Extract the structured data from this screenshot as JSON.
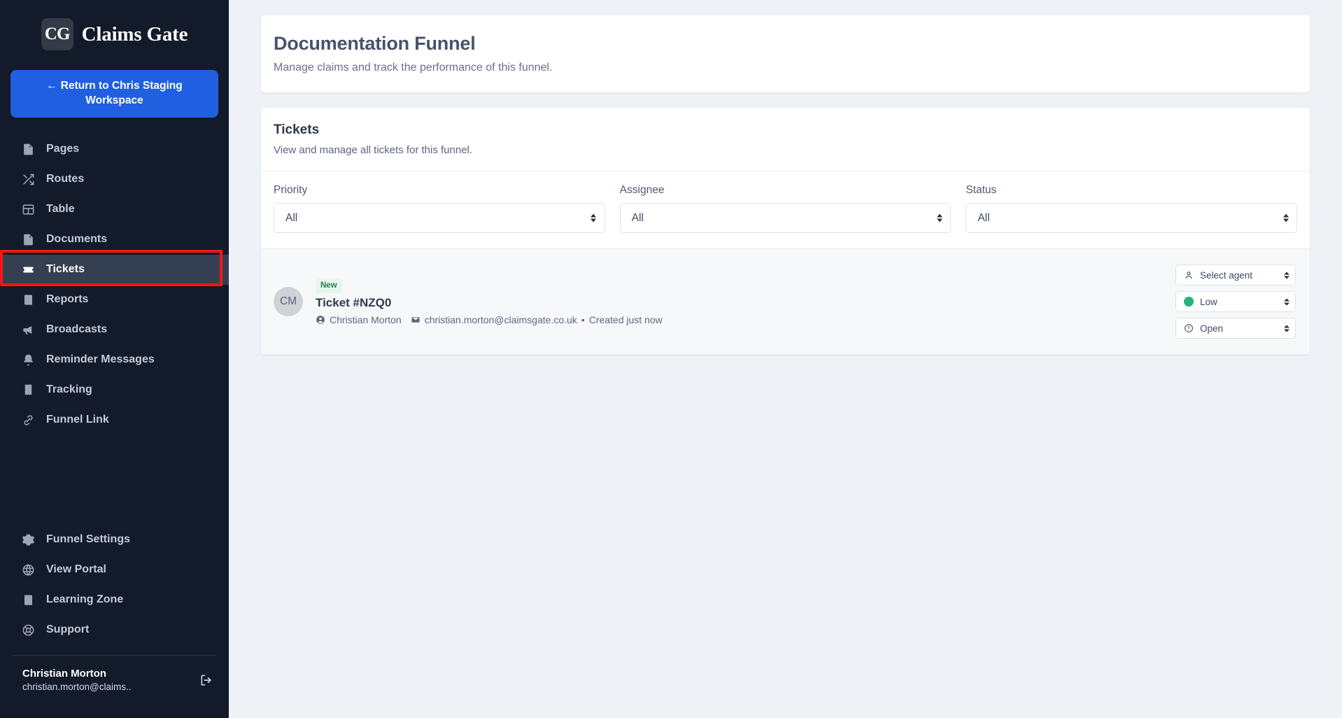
{
  "sidebar": {
    "brand": {
      "mark": "CG",
      "name": "Claims Gate"
    },
    "return_button": {
      "arrow": "←",
      "label": "Return to Chris Staging Workspace"
    },
    "nav_primary": [
      {
        "label": "Pages",
        "icon": "page-icon",
        "active": false
      },
      {
        "label": "Routes",
        "icon": "shuffle-icon",
        "active": false
      },
      {
        "label": "Table",
        "icon": "table-icon",
        "active": false
      },
      {
        "label": "Documents",
        "icon": "document-icon",
        "active": false
      },
      {
        "label": "Tickets",
        "icon": "ticket-icon",
        "active": true
      },
      {
        "label": "Reports",
        "icon": "report-icon",
        "active": false
      },
      {
        "label": "Broadcasts",
        "icon": "megaphone-icon",
        "active": false
      },
      {
        "label": "Reminder Messages",
        "icon": "bell-icon",
        "active": false
      },
      {
        "label": "Tracking",
        "icon": "receipt-icon",
        "active": false
      },
      {
        "label": "Funnel Link",
        "icon": "link-icon",
        "active": false
      }
    ],
    "nav_secondary": [
      {
        "label": "Funnel Settings",
        "icon": "gear-icon"
      },
      {
        "label": "View Portal",
        "icon": "globe-icon"
      },
      {
        "label": "Learning Zone",
        "icon": "book-icon"
      },
      {
        "label": "Support",
        "icon": "lifebuoy-icon"
      }
    ],
    "user": {
      "name": "Christian Morton",
      "email": "christian.morton@claims..",
      "logout_icon": "logout-icon"
    }
  },
  "page": {
    "title": "Documentation Funnel",
    "subtitle": "Manage claims and track the performance of this funnel."
  },
  "tickets_card": {
    "title": "Tickets",
    "subtitle": "View and manage all tickets for this funnel.",
    "filters": [
      {
        "label": "Priority",
        "value": "All",
        "name": "priority-filter"
      },
      {
        "label": "Assignee",
        "value": "All",
        "name": "assignee-filter"
      },
      {
        "label": "Status",
        "value": "All",
        "name": "status-filter"
      }
    ],
    "rows": [
      {
        "avatar_initials": "CM",
        "badge": "New",
        "title": "Ticket #NZQ0",
        "person_icon": "user-circle-icon",
        "person": "Christian Morton",
        "email_icon": "envelope-icon",
        "email": "christian.morton@claimsgate.co.uk",
        "separator": "•",
        "created": "Created just now",
        "controls": {
          "agent": {
            "icon": "user-icon",
            "value": "Select agent"
          },
          "priority": {
            "icon": "green-dot-icon",
            "value": "Low",
            "color": "#23b47c"
          },
          "status": {
            "icon": "exclamation-circle-icon",
            "value": "Open"
          }
        }
      }
    ]
  },
  "annotations": {
    "color": "#fd1414",
    "boxes": [
      {
        "name": "tickets-nav-highlight"
      },
      {
        "name": "ticket-controls-highlight"
      }
    ]
  }
}
